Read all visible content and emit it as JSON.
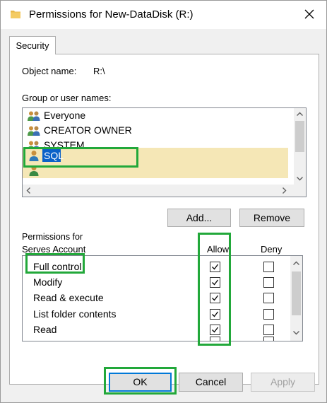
{
  "window": {
    "title": "Permissions for New-DataDisk (R:)",
    "title_icon": "folder-icon",
    "close_icon": "close-icon"
  },
  "tabs": [
    {
      "label": "Security",
      "selected": true
    }
  ],
  "object_name": {
    "label": "Object name:",
    "value": "R:\\"
  },
  "group_users": {
    "label": "Group or user names:",
    "items": [
      {
        "name": "Everyone",
        "icon": "group-users-icon"
      },
      {
        "name": "CREATOR OWNER",
        "icon": "group-users-icon"
      },
      {
        "name": "SYSTEM",
        "icon": "group-users-icon"
      },
      {
        "name": "SQL",
        "icon": "user-icon",
        "selected": true
      },
      {
        "name": "",
        "icon": "user-icon"
      }
    ]
  },
  "buttons": {
    "add": "Add...",
    "remove": "Remove",
    "ok": "OK",
    "cancel": "Cancel",
    "apply": "Apply"
  },
  "permissions": {
    "label_line1": "Permissions for",
    "label_line2": "Serves Account",
    "allow_header": "Allow",
    "deny_header": "Deny",
    "rows": [
      {
        "name": "Full control",
        "allow": true,
        "deny": false
      },
      {
        "name": "Modify",
        "allow": true,
        "deny": false
      },
      {
        "name": "Read & execute",
        "allow": true,
        "deny": false
      },
      {
        "name": "List folder contents",
        "allow": true,
        "deny": false
      },
      {
        "name": "Read",
        "allow": true,
        "deny": false
      }
    ]
  },
  "colors": {
    "highlight_green": "#22a83a",
    "selection_blue": "#0b61c8",
    "row_highlight": "#f5e7b6",
    "dialog_bg": "#f0f0f0"
  }
}
